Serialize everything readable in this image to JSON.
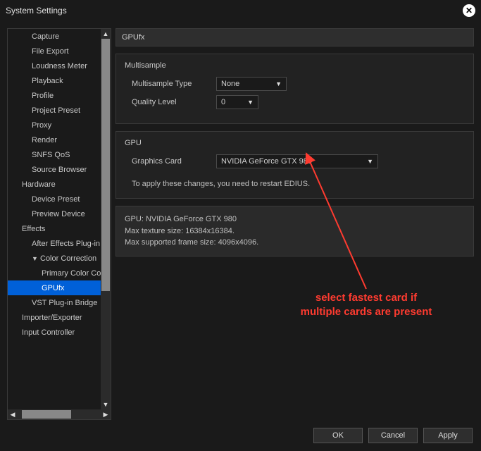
{
  "window": {
    "title": "System Settings"
  },
  "sidebar": {
    "items": [
      {
        "label": "Capture",
        "level": 1
      },
      {
        "label": "File Export",
        "level": 1
      },
      {
        "label": "Loudness Meter",
        "level": 1
      },
      {
        "label": "Playback",
        "level": 1
      },
      {
        "label": "Profile",
        "level": 1
      },
      {
        "label": "Project Preset",
        "level": 1
      },
      {
        "label": "Proxy",
        "level": 1
      },
      {
        "label": "Render",
        "level": 1
      },
      {
        "label": "SNFS QoS",
        "level": 1
      },
      {
        "label": "Source Browser",
        "level": 1
      },
      {
        "label": "Hardware",
        "level": 0
      },
      {
        "label": "Device Preset",
        "level": 1
      },
      {
        "label": "Preview Device",
        "level": 1
      },
      {
        "label": "Effects",
        "level": 0
      },
      {
        "label": "After Effects Plug-in Bridge",
        "level": 1
      },
      {
        "label": "Color Correction",
        "level": 1,
        "expanded": true
      },
      {
        "label": "Primary Color Correction",
        "level": 2
      },
      {
        "label": "GPUfx",
        "level": 2,
        "selected": true
      },
      {
        "label": "VST Plug-in Bridge",
        "level": 1
      },
      {
        "label": "Importer/Exporter",
        "level": 0
      },
      {
        "label": "Input Controller",
        "level": 0
      }
    ]
  },
  "panel": {
    "title": "GPUfx",
    "multisample": {
      "title": "Multisample",
      "type_label": "Multisample Type",
      "type_value": "None",
      "quality_label": "Quality Level",
      "quality_value": "0"
    },
    "gpu": {
      "title": "GPU",
      "card_label": "Graphics Card",
      "card_value": "NVIDIA GeForce GTX 980",
      "restart_note": "To apply these changes, you need to restart EDIUS."
    },
    "info": {
      "line1": "GPU: NVIDIA GeForce GTX 980",
      "line2": "Max texture size: 16384x16384.",
      "line3": "Max supported frame size: 4096x4096."
    }
  },
  "buttons": {
    "ok": "OK",
    "cancel": "Cancel",
    "apply": "Apply"
  },
  "annotation": {
    "text": "select fastest card if multiple cards are present"
  }
}
